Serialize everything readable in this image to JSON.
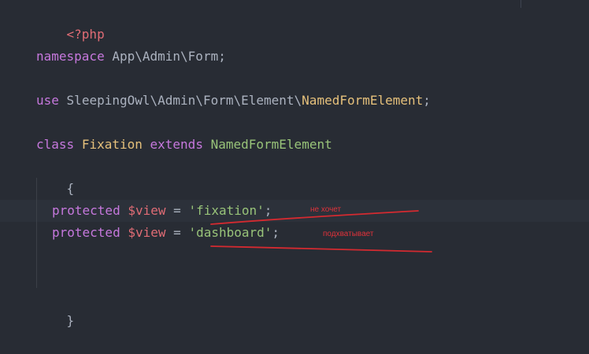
{
  "editor": {
    "lines": {
      "php_open": "<?php",
      "namespace_kw": "namespace",
      "namespace_name": "App\\Admin\\Form",
      "namespace_end": ";",
      "use_kw": "use",
      "use_path": "SleepingOwl\\Admin\\Form\\Element\\",
      "use_class": "NamedFormElement",
      "use_end": ";",
      "class_kw": "class",
      "class_name": "Fixation",
      "extends_kw": "extends",
      "parent_name": "NamedFormElement",
      "brace_open": "{",
      "prop1_kw": "protected",
      "prop1_var": "$view",
      "prop1_eq": "=",
      "prop1_val": "'fixation'",
      "prop1_end": ";",
      "prop2_kw": "protected",
      "prop2_var": "$view",
      "prop2_eq": "=",
      "prop2_val": "'dashboard'",
      "prop2_end": ";",
      "brace_close": "}"
    },
    "colors": {
      "background": "#282c34",
      "keyword": "#c678dd",
      "string": "#98c379",
      "class": "#e5c07b",
      "variable": "#e06c75",
      "annotation": "#e0323a"
    }
  },
  "annotations": {
    "note1": "не хочет",
    "note2": "подхватывает"
  }
}
